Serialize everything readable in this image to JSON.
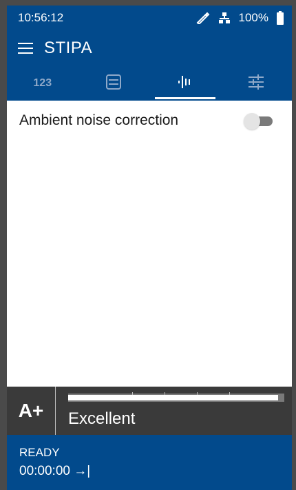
{
  "statusbar": {
    "time": "10:56:12",
    "battery_text": "100%",
    "icons": [
      "probe-icon",
      "network-icon",
      "battery-icon"
    ]
  },
  "appbar": {
    "title": "STIPA"
  },
  "tabs": [
    {
      "label": "123",
      "icon": "numbers-icon",
      "active": false
    },
    {
      "label": "",
      "icon": "list-icon",
      "active": false
    },
    {
      "label": "",
      "icon": "waveform-icon",
      "active": true
    },
    {
      "label": "",
      "icon": "sliders-icon",
      "active": false
    }
  ],
  "settings": {
    "ambient_noise_correction": {
      "label": "Ambient noise correction",
      "enabled": false
    }
  },
  "result": {
    "grade": "A+",
    "rating": "Excellent",
    "meter_fraction": 0.97
  },
  "footer": {
    "status": "READY",
    "timer": "00:00:00 →|"
  },
  "colors": {
    "primary": "#024a8c",
    "panel": "#3a3a3a"
  }
}
